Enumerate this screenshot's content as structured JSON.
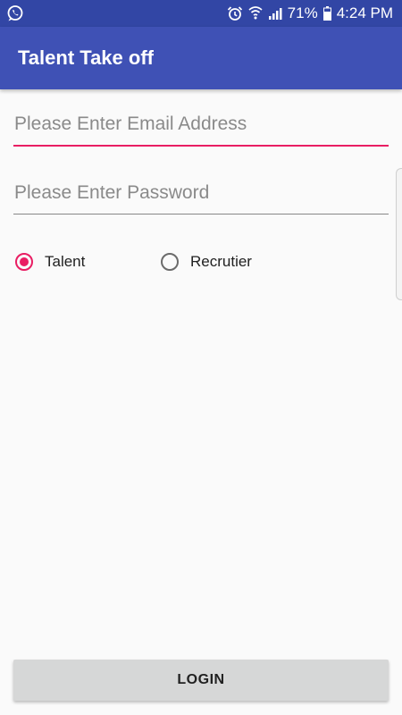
{
  "status_bar": {
    "left_icons": [
      "whatsapp-icon"
    ],
    "right_icons": [
      "alarm-icon",
      "wifi-icon",
      "signal-icon",
      "battery-icon"
    ],
    "battery": "71%",
    "time": "4:24 PM",
    "background": "#3246a5"
  },
  "app_bar": {
    "title": "Talent Take off",
    "background": "#3f51b5"
  },
  "form": {
    "email": {
      "placeholder": "Please Enter Email Address",
      "value": "",
      "focused": true
    },
    "password": {
      "placeholder": "Please Enter Password",
      "value": ""
    },
    "role_options": [
      {
        "label": "Talent",
        "selected": true
      },
      {
        "label": "Recrutier",
        "selected": false
      }
    ]
  },
  "login_button": {
    "label": "LOGIN"
  },
  "colors": {
    "accent": "#e91e63",
    "primary": "#3f51b5",
    "primary_dark": "#3246a5",
    "background": "#fafafa",
    "button": "#d6d7d7"
  }
}
